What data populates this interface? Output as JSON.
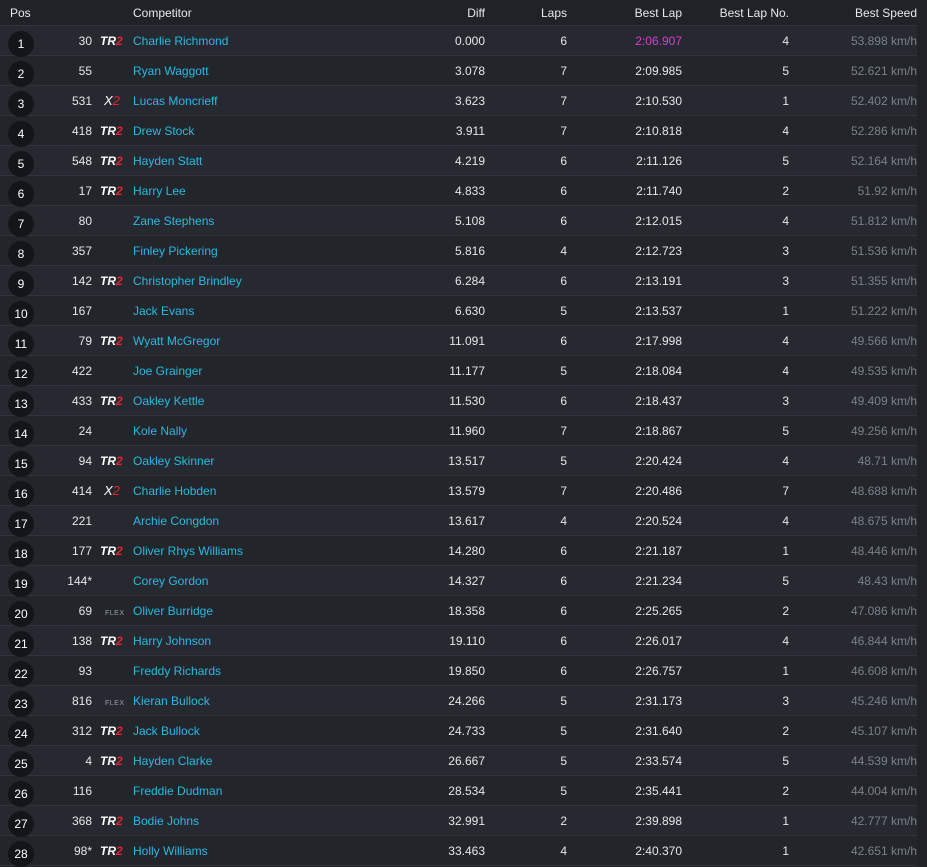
{
  "colors": {
    "background": "#1f2227",
    "row_odd": "#262a30",
    "row_even": "#22262b",
    "name_link": "#29b8e3",
    "fastest_lap": "#d63bd6",
    "speed_text": "#7b8088",
    "class_accent_red": "#e3232e"
  },
  "headers": {
    "pos": "Pos",
    "competitor": "Competitor",
    "diff": "Diff",
    "laps": "Laps",
    "best_lap": "Best Lap",
    "best_lap_no": "Best Lap No.",
    "best_speed": "Best Speed"
  },
  "rows": [
    {
      "pos": "1",
      "num": "30",
      "cls": "TR2",
      "name": "Charlie Richmond",
      "diff": "0.000",
      "laps": "6",
      "best_lap": "2:06.907",
      "best_lap_no": "4",
      "speed": "53.898 km/h",
      "fastest": true
    },
    {
      "pos": "2",
      "num": "55",
      "cls": "",
      "name": "Ryan Waggott",
      "diff": "3.078",
      "laps": "7",
      "best_lap": "2:09.985",
      "best_lap_no": "5",
      "speed": "52.621 km/h"
    },
    {
      "pos": "3",
      "num": "531",
      "cls": "X2",
      "name": "Lucas Moncrieff",
      "diff": "3.623",
      "laps": "7",
      "best_lap": "2:10.530",
      "best_lap_no": "1",
      "speed": "52.402 km/h"
    },
    {
      "pos": "4",
      "num": "418",
      "cls": "TR2",
      "name": "Drew Stock",
      "diff": "3.911",
      "laps": "7",
      "best_lap": "2:10.818",
      "best_lap_no": "4",
      "speed": "52.286 km/h"
    },
    {
      "pos": "5",
      "num": "548",
      "cls": "TR2",
      "name": "Hayden Statt",
      "diff": "4.219",
      "laps": "6",
      "best_lap": "2:11.126",
      "best_lap_no": "5",
      "speed": "52.164 km/h"
    },
    {
      "pos": "6",
      "num": "17",
      "cls": "TR2",
      "name": "Harry Lee",
      "diff": "4.833",
      "laps": "6",
      "best_lap": "2:11.740",
      "best_lap_no": "2",
      "speed": "51.92 km/h"
    },
    {
      "pos": "7",
      "num": "80",
      "cls": "",
      "name": "Zane Stephens",
      "diff": "5.108",
      "laps": "6",
      "best_lap": "2:12.015",
      "best_lap_no": "4",
      "speed": "51.812 km/h"
    },
    {
      "pos": "8",
      "num": "357",
      "cls": "",
      "name": "Finley Pickering",
      "diff": "5.816",
      "laps": "4",
      "best_lap": "2:12.723",
      "best_lap_no": "3",
      "speed": "51.536 km/h"
    },
    {
      "pos": "9",
      "num": "142",
      "cls": "TR2",
      "name": "Christopher Brindley",
      "diff": "6.284",
      "laps": "6",
      "best_lap": "2:13.191",
      "best_lap_no": "3",
      "speed": "51.355 km/h"
    },
    {
      "pos": "10",
      "num": "167",
      "cls": "",
      "name": "Jack Evans",
      "diff": "6.630",
      "laps": "5",
      "best_lap": "2:13.537",
      "best_lap_no": "1",
      "speed": "51.222 km/h"
    },
    {
      "pos": "11",
      "num": "79",
      "cls": "TR2",
      "name": "Wyatt McGregor",
      "diff": "11.091",
      "laps": "6",
      "best_lap": "2:17.998",
      "best_lap_no": "4",
      "speed": "49.566 km/h"
    },
    {
      "pos": "12",
      "num": "422",
      "cls": "",
      "name": "Joe Grainger",
      "diff": "11.177",
      "laps": "5",
      "best_lap": "2:18.084",
      "best_lap_no": "4",
      "speed": "49.535 km/h"
    },
    {
      "pos": "13",
      "num": "433",
      "cls": "TR2",
      "name": "Oakley Kettle",
      "diff": "11.530",
      "laps": "6",
      "best_lap": "2:18.437",
      "best_lap_no": "3",
      "speed": "49.409 km/h"
    },
    {
      "pos": "14",
      "num": "24",
      "cls": "",
      "name": "Kole Nally",
      "diff": "11.960",
      "laps": "7",
      "best_lap": "2:18.867",
      "best_lap_no": "5",
      "speed": "49.256 km/h"
    },
    {
      "pos": "15",
      "num": "94",
      "cls": "TR2",
      "name": "Oakley Skinner",
      "diff": "13.517",
      "laps": "5",
      "best_lap": "2:20.424",
      "best_lap_no": "4",
      "speed": "48.71 km/h"
    },
    {
      "pos": "16",
      "num": "414",
      "cls": "X2",
      "name": "Charlie Hobden",
      "diff": "13.579",
      "laps": "7",
      "best_lap": "2:20.486",
      "best_lap_no": "7",
      "speed": "48.688 km/h"
    },
    {
      "pos": "17",
      "num": "221",
      "cls": "",
      "name": "Archie Congdon",
      "diff": "13.617",
      "laps": "4",
      "best_lap": "2:20.524",
      "best_lap_no": "4",
      "speed": "48.675 km/h"
    },
    {
      "pos": "18",
      "num": "177",
      "cls": "TR2",
      "name": "Oliver Rhys Williams",
      "diff": "14.280",
      "laps": "6",
      "best_lap": "2:21.187",
      "best_lap_no": "1",
      "speed": "48.446 km/h"
    },
    {
      "pos": "19",
      "num": "144*",
      "cls": "",
      "name": "Corey Gordon",
      "diff": "14.327",
      "laps": "6",
      "best_lap": "2:21.234",
      "best_lap_no": "5",
      "speed": "48.43 km/h"
    },
    {
      "pos": "20",
      "num": "69",
      "cls": "FLEX",
      "name": "Oliver Burridge",
      "diff": "18.358",
      "laps": "6",
      "best_lap": "2:25.265",
      "best_lap_no": "2",
      "speed": "47.086 km/h"
    },
    {
      "pos": "21",
      "num": "138",
      "cls": "TR2",
      "name": "Harry Johnson",
      "diff": "19.110",
      "laps": "6",
      "best_lap": "2:26.017",
      "best_lap_no": "4",
      "speed": "46.844 km/h"
    },
    {
      "pos": "22",
      "num": "93",
      "cls": "",
      "name": "Freddy Richards",
      "diff": "19.850",
      "laps": "6",
      "best_lap": "2:26.757",
      "best_lap_no": "1",
      "speed": "46.608 km/h"
    },
    {
      "pos": "23",
      "num": "816",
      "cls": "FLEX",
      "name": "Kieran Bullock",
      "diff": "24.266",
      "laps": "5",
      "best_lap": "2:31.173",
      "best_lap_no": "3",
      "speed": "45.246 km/h"
    },
    {
      "pos": "24",
      "num": "312",
      "cls": "TR2",
      "name": "Jack Bullock",
      "diff": "24.733",
      "laps": "5",
      "best_lap": "2:31.640",
      "best_lap_no": "2",
      "speed": "45.107 km/h"
    },
    {
      "pos": "25",
      "num": "4",
      "cls": "TR2",
      "name": "Hayden Clarke",
      "diff": "26.667",
      "laps": "5",
      "best_lap": "2:33.574",
      "best_lap_no": "5",
      "speed": "44.539 km/h"
    },
    {
      "pos": "26",
      "num": "116",
      "cls": "",
      "name": "Freddie Dudman",
      "diff": "28.534",
      "laps": "5",
      "best_lap": "2:35.441",
      "best_lap_no": "2",
      "speed": "44.004 km/h"
    },
    {
      "pos": "27",
      "num": "368",
      "cls": "TR2",
      "name": "Bodie Johns",
      "diff": "32.991",
      "laps": "2",
      "best_lap": "2:39.898",
      "best_lap_no": "1",
      "speed": "42.777 km/h"
    },
    {
      "pos": "28",
      "num": "98*",
      "cls": "TR2",
      "name": "Holly Williams",
      "diff": "33.463",
      "laps": "4",
      "best_lap": "2:40.370",
      "best_lap_no": "1",
      "speed": "42.651 km/h"
    }
  ]
}
